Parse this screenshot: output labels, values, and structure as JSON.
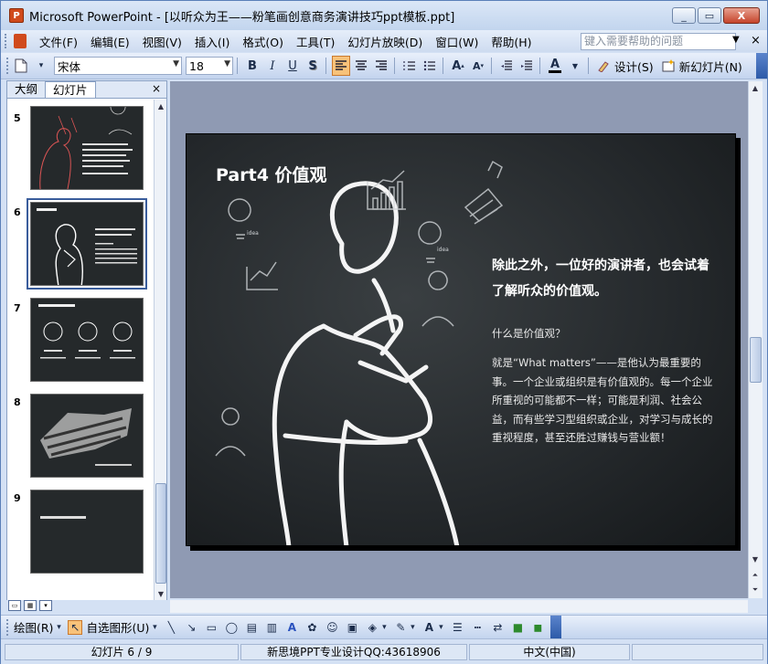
{
  "window": {
    "title": "Microsoft PowerPoint - [以听众为王——粉笔画创意商务演讲技巧ppt模板.ppt]",
    "app_icon_label": "P",
    "minimize": "_",
    "restore": "▭",
    "close": "X"
  },
  "menu": {
    "items": [
      "文件(F)",
      "编辑(E)",
      "视图(V)",
      "插入(I)",
      "格式(O)",
      "工具(T)",
      "幻灯片放映(D)",
      "窗口(W)",
      "帮助(H)"
    ],
    "help_placeholder": "键入需要帮助的问题",
    "close_glyph": "×"
  },
  "toolbar": {
    "font": "宋体",
    "size": "18",
    "bold": "B",
    "italic": "I",
    "underline": "U",
    "shadow": "S",
    "design_label": "设计(S)",
    "new_slide_label": "新幻灯片(N)"
  },
  "leftpane": {
    "tabs": [
      "大纲",
      "幻灯片"
    ],
    "close_glyph": "×",
    "slides": [
      {
        "num": "5"
      },
      {
        "num": "6"
      },
      {
        "num": "7"
      },
      {
        "num": "8"
      },
      {
        "num": "9"
      }
    ],
    "selected": "6"
  },
  "slide": {
    "title": "Part4 价值观",
    "lead": "除此之外，一位好的演讲者，也会试着了解听众的价值观。",
    "question": "什么是价值观？",
    "body": "就是“What matters”——是他认为最重要的事。一个企业或组织是有价值观的。每一个企业所重视的可能都不一样；可能是利润、社会公益，而有些学习型组织或企业，对学习与成长的重视程度，甚至还胜过赚钱与营业额！",
    "icon_label_1": "idea",
    "icon_label_2": "idea"
  },
  "drawbar": {
    "draw_label": "绘图(R)",
    "autoshape_label": "自选图形(U)"
  },
  "status": {
    "slide_pos": "幻灯片 6 / 9",
    "design": "新思境PPT专业设计QQ:43618906",
    "language": "中文(中国)"
  },
  "colors": {
    "accent": "#3a5d9c",
    "chalkboard": "#24282b",
    "canvas_bg": "#8f9ab3"
  }
}
